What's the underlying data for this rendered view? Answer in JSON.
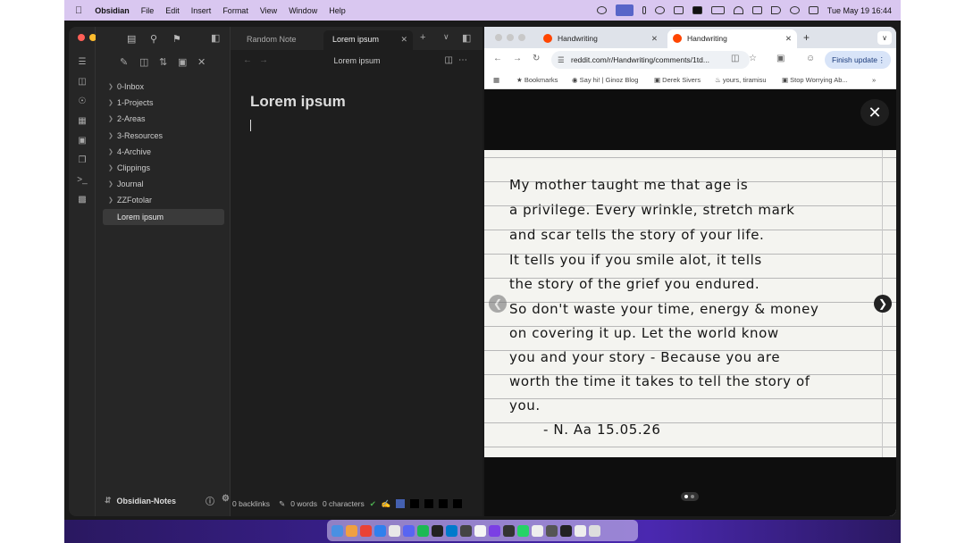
{
  "menubar": {
    "app": "Obsidian",
    "items": [
      "File",
      "Edit",
      "Insert",
      "Format",
      "View",
      "Window",
      "Help"
    ],
    "clock": "Tue May 19  16:44"
  },
  "obsidian": {
    "tabs": [
      {
        "label": "Random Note"
      },
      {
        "label": "Lorem ipsum",
        "active": true
      }
    ],
    "view_title": "Lorem ipsum",
    "folders": [
      "0-Inbox",
      "1-Projects",
      "2-Areas",
      "3-Resources",
      "4-Archive",
      "Clippings",
      "Journal",
      "ZZFotolar"
    ],
    "selected_file": "Lorem ipsum",
    "vault_name": "Obsidian-Notes",
    "doc_title": "Lorem ipsum",
    "status": {
      "backlinks": "0 backlinks",
      "words": "0 words",
      "characters": "0 characters"
    }
  },
  "chrome": {
    "tabs": [
      {
        "label": "Handwriting"
      },
      {
        "label": "Handwriting",
        "active": true
      }
    ],
    "url": "reddit.com/r/Handwriting/comments/1td...",
    "finish_update": "Finish update",
    "bookmarks": [
      "Bookmarks",
      "Say hi! | Ginoz Blog",
      "Derek Sivers",
      "yours, tiramisu",
      "Stop Worrying Ab..."
    ]
  },
  "handwriting": {
    "lines": [
      "My mother taught me that age is",
      "a privilege. Every wrinkle, stretch mark",
      "and scar tells the story of your life.",
      "It tells you if you smile alot, it tells",
      "the story of the grief you endured.",
      "So don't waste your time, energy & money",
      "on covering it up. Let the world know",
      "you and your story - Because you are",
      "worth the time it takes to tell the story of",
      "you.",
      "- N. Aa 15.05.26"
    ]
  },
  "colors": {
    "menubar_bg": "#d9c7f0",
    "obsidian_bg": "#1e1e1e",
    "reddit_orange": "#ff4500",
    "accent_blue": "#4460b0"
  }
}
